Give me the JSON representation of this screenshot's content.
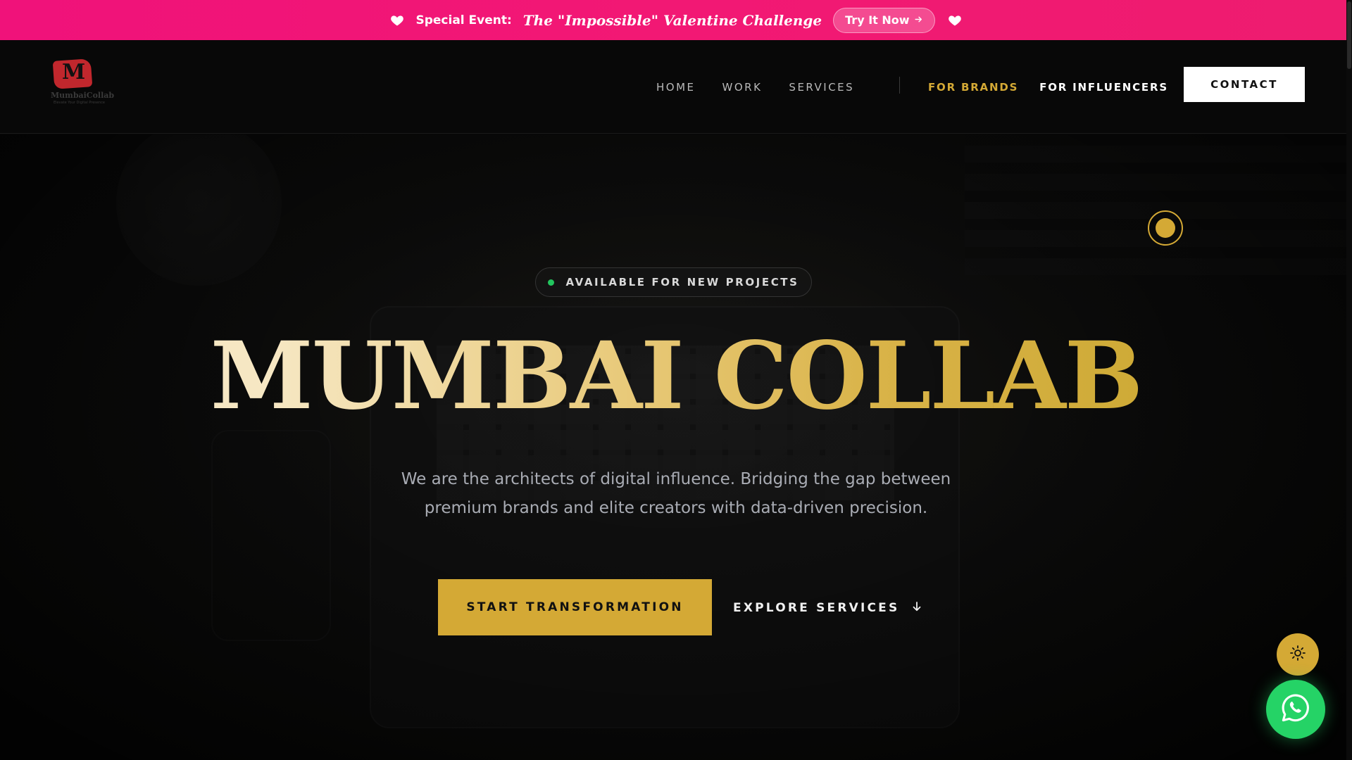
{
  "promo": {
    "label": "Special Event:",
    "event": "The \"Impossible\" Valentine Challenge",
    "cta": "Try It Now",
    "cta_icon": "arrow-right-icon",
    "icon": "heart-icon",
    "color": "#f0127a"
  },
  "header": {
    "logo": {
      "letter": "M",
      "name": "MumbaiCollab",
      "tagline": "Elevate Your Digital Presence"
    },
    "nav": [
      {
        "label": "HOME"
      },
      {
        "label": "WORK"
      },
      {
        "label": "SERVICES"
      }
    ],
    "audience": [
      {
        "label": "FOR BRANDS"
      },
      {
        "label": "FOR INFLUENCERS"
      }
    ],
    "contact": "CONTACT"
  },
  "hero": {
    "badge": "AVAILABLE FOR NEW PROJECTS",
    "title": "MUMBAI COLLAB",
    "subtitle_line1": "We are the architects of digital influence. Bridging the gap between",
    "subtitle_line2": "premium brands and elite creators with data-driven precision.",
    "primary_cta": "START TRANSFORMATION",
    "secondary_cta": "EXPLORE SERVICES",
    "secondary_icon": "arrow-down-icon"
  },
  "floating": {
    "theme_icon": "sun-icon",
    "chat_icon": "whatsapp-icon"
  },
  "colors": {
    "accent": "#d4a935",
    "promo": "#f0127a",
    "whatsapp": "#25d366",
    "status": "#22c55e"
  }
}
